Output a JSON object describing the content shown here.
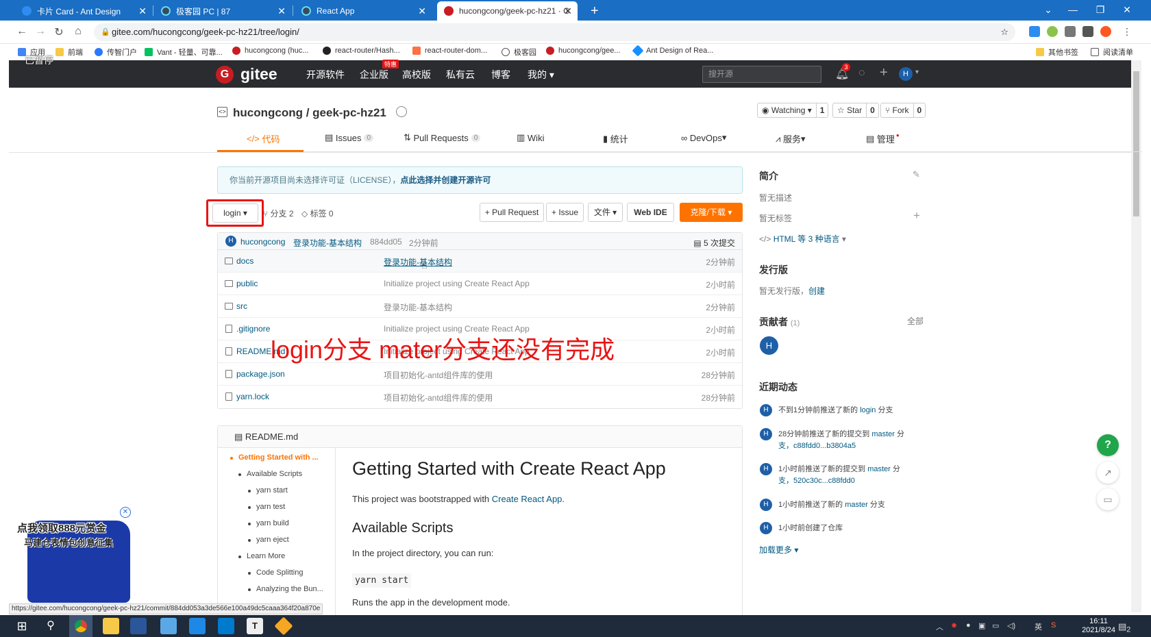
{
  "browser": {
    "tabs": [
      {
        "title": "卡片 Card - Ant Design",
        "color": "#2f8cf0"
      },
      {
        "title": "极客园 PC | 87",
        "color": "#61dafb"
      },
      {
        "title": "React App",
        "color": "#61dafb"
      },
      {
        "title": "hucongcong/geek-pc-hz21 · G",
        "color": "#c71d23"
      }
    ],
    "new_tab": "+",
    "url": "gitee.com/hucongcong/geek-pc-hz21/tree/login/",
    "bookmarks": [
      "应用",
      "前端",
      "传智门户",
      "Vant - 轻量、可靠...",
      "hucongcong (huc...",
      "react-router/Hash...",
      "react-router-dom...",
      "极客园",
      "hucongcong/gee...",
      "Ant Design of Rea..."
    ],
    "bookmarks_right": [
      "其他书签",
      "阅读清单"
    ],
    "paused_label": "已暂停",
    "status_url": "https://gitee.com/hucongcong/geek-pc-hz21/commit/884dd053a3de566e100a49dc5caaa364f20a870e"
  },
  "gitee": {
    "logo": "gitee",
    "nav": [
      "开源软件",
      "企业版",
      "高校版",
      "私有云",
      "博客",
      "我的"
    ],
    "nav_badge": "特惠",
    "search_placeholder": "搜开源",
    "notif_count": "3",
    "avatar": "H"
  },
  "repo": {
    "owner_repo": "hucongcong / geek-pc-hz21",
    "watch": {
      "label": "Watching",
      "count": "1"
    },
    "star": {
      "label": "Star",
      "count": "0"
    },
    "fork": {
      "label": "Fork",
      "count": "0"
    },
    "tabs": [
      {
        "label": "代码",
        "badge": ""
      },
      {
        "label": "Issues",
        "badge": "0"
      },
      {
        "label": "Pull Requests",
        "badge": "0"
      },
      {
        "label": "Wiki",
        "badge": ""
      },
      {
        "label": "统计",
        "badge": ""
      },
      {
        "label": "DevOps",
        "badge": ""
      },
      {
        "label": "服务",
        "badge": ""
      },
      {
        "label": "管理",
        "badge": ""
      }
    ],
    "license_text": "你当前开源项目尚未选择许可证（LICENSE），",
    "license_link": "点此选择并创建开源许可",
    "branch": "login",
    "branch_count": "分支 2",
    "tag_count": "标签 0",
    "actions": [
      "+ Pull Request",
      "+ Issue",
      "文件",
      "Web IDE",
      "克隆/下载"
    ],
    "commit": {
      "author": "hucongcong",
      "message": "登录功能-基本结构",
      "hash": "884dd05",
      "time": "2分钟前",
      "count": "5 次提交"
    },
    "files": [
      {
        "name": "docs",
        "type": "folder",
        "msg": "登录功能-基本结构",
        "time": "2分钟前"
      },
      {
        "name": "public",
        "type": "folder",
        "msg": "Initialize project using Create React App",
        "time": "2小时前"
      },
      {
        "name": "src",
        "type": "folder",
        "msg": "登录功能-基本结构",
        "time": "2分钟前"
      },
      {
        "name": ".gitignore",
        "type": "file",
        "msg": "Initialize project using Create React App",
        "time": "2小时前"
      },
      {
        "name": "README.md",
        "type": "file",
        "msg": "Initialize project using Create React App",
        "time": "2小时前"
      },
      {
        "name": "package.json",
        "type": "file",
        "msg": "项目初始化-antd组件库的使用",
        "time": "28分钟前"
      },
      {
        "name": "yarn.lock",
        "type": "file",
        "msg": "项目初始化-antd组件库的使用",
        "time": "28分钟前"
      }
    ],
    "overlay_note": "login分支   mater分支还没有完成"
  },
  "readme": {
    "filename": "README.md",
    "toc": [
      "Getting Started with ...",
      "Available Scripts",
      "yarn start",
      "yarn test",
      "yarn build",
      "yarn eject",
      "Learn More",
      "Code Splitting",
      "Analyzing the Bun..."
    ],
    "h1": "Getting Started with Create React App",
    "p1_prefix": "This project was bootstrapped with ",
    "p1_link": "Create React App",
    "p1_suffix": ".",
    "h2": "Available Scripts",
    "p2": "In the project directory, you can run:",
    "code": "yarn start",
    "p3": "Runs the app in the development mode."
  },
  "sidebar": {
    "intro_title": "简介",
    "no_desc": "暂无描述",
    "no_tags": "暂无标签",
    "lang": "HTML 等 3 种语言",
    "release_title": "发行版",
    "no_release": "暂无发行版，",
    "create": "创建",
    "contrib_title": "贡献者",
    "contrib_count": "(1)",
    "all": "全部",
    "contrib_avatar": "H",
    "activity_title": "近期动态",
    "activities": [
      {
        "text": "不到1分钟前推送了新的",
        "link": "login",
        "tail": "分支",
        "line2": ""
      },
      {
        "text": "28分钟前推送了新的提交到",
        "link": "master",
        "tail": "分",
        "line2": "支，c88fdd0...b3804a5"
      },
      {
        "text": "1小时前推送了新的提交到",
        "link": "master",
        "tail": "分",
        "line2": "支，520c30c...c88fdd0"
      },
      {
        "text": "1小时前推送了新的",
        "link": "master",
        "tail": "分支",
        "line2": ""
      },
      {
        "text": "1小时前创建了仓库",
        "link": "",
        "tail": "",
        "line2": ""
      }
    ],
    "load_more": "加载更多"
  },
  "promo": {
    "line1": "点我领取888元赏金",
    "line2": "马建仓表情包创意征集"
  },
  "taskbar": {
    "time": "16:11",
    "date": "2021/8/24",
    "ime": "英",
    "notif": "2"
  }
}
